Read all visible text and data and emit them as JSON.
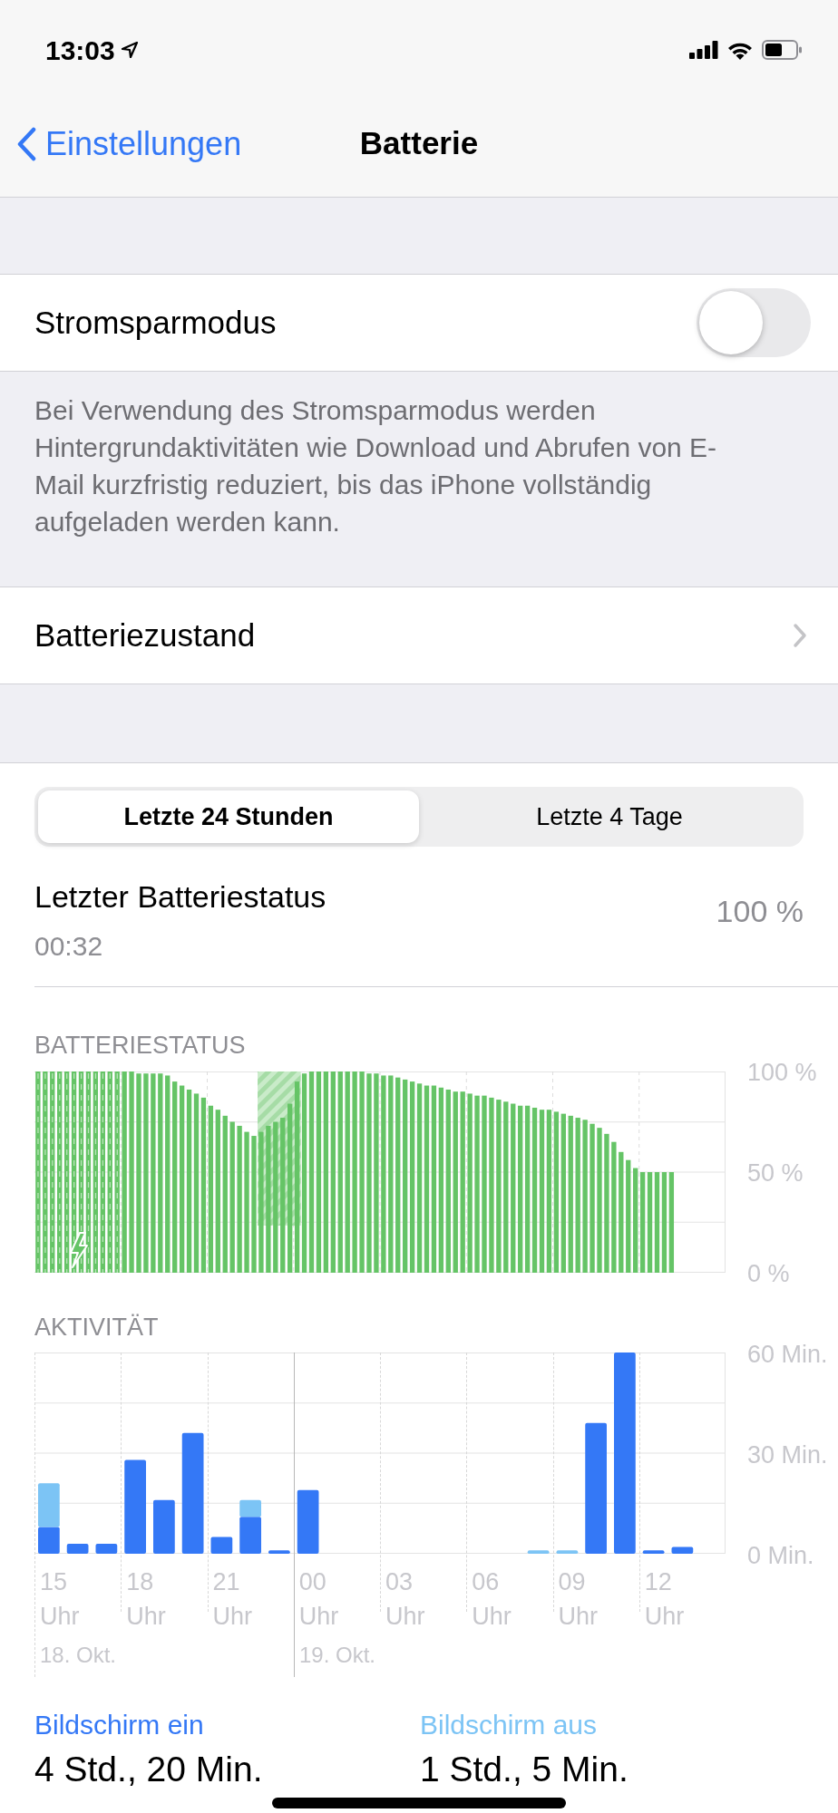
{
  "status_bar": {
    "time": "13:03"
  },
  "nav": {
    "back": "Einstellungen",
    "title": "Batterie"
  },
  "low_power": {
    "label": "Stromsparmodus",
    "on": false,
    "footer": "Bei Verwendung des Stromsparmodus werden Hintergrundaktivitäten wie Download und Abrufen von E-Mail kurzfristig reduziert, bis das iPhone vollständig aufgeladen werden kann."
  },
  "battery_health": {
    "label": "Batteriezustand"
  },
  "tabs": [
    {
      "label": "Letzte 24 Stunden",
      "selected": true
    },
    {
      "label": "Letzte 4 Tage",
      "selected": false
    }
  ],
  "last_status": {
    "label": "Letzter Batteriestatus",
    "time": "00:32",
    "value": "100 %"
  },
  "battery_chart": {
    "title": "BATTERIESTATUS",
    "chart_data": {
      "type": "bar",
      "grid": true,
      "ylim": [
        0,
        100
      ],
      "yticks": [
        {
          "value": 100,
          "label": "100 %"
        },
        {
          "value": 50,
          "label": "50 %"
        },
        {
          "value": 0,
          "label": "0 %"
        }
      ],
      "series": [
        {
          "color": "#65c466",
          "values": [
            100,
            100,
            100,
            100,
            100,
            100,
            100,
            100,
            100,
            100,
            100,
            100,
            100,
            100,
            99,
            99,
            99,
            99,
            98,
            95,
            93,
            91,
            89,
            87,
            83,
            81,
            78,
            75,
            73,
            70,
            68,
            70,
            73,
            75,
            77,
            84,
            95,
            99,
            100,
            100,
            100,
            100,
            100,
            100,
            100,
            100,
            99,
            99,
            98,
            98,
            97,
            96,
            95,
            94,
            93,
            93,
            92,
            91,
            90,
            90,
            89,
            88,
            88,
            87,
            86,
            85,
            84,
            83,
            83,
            82,
            81,
            81,
            80,
            79,
            78,
            77,
            76,
            74,
            72,
            69,
            65,
            60,
            56,
            52,
            50,
            50,
            50,
            50,
            50,
            null,
            null,
            null,
            null,
            null,
            null,
            null
          ]
        }
      ]
    }
  },
  "activity_chart": {
    "title": "AKTIVITÄT",
    "date_labels": [
      "18. Okt.",
      "19. Okt."
    ],
    "chart_data": {
      "type": "bar",
      "stacked": true,
      "grid": true,
      "ylim": [
        0,
        60
      ],
      "yticks": [
        {
          "value": 60,
          "label": "60 Min."
        },
        {
          "value": 30,
          "label": "30 Min."
        },
        {
          "value": 0,
          "label": "0 Min."
        }
      ],
      "categories": [
        "15 Uhr",
        null,
        null,
        "18 Uhr",
        null,
        null,
        "21 Uhr",
        null,
        null,
        "00 Uhr",
        null,
        null,
        "03 Uhr",
        null,
        null,
        "06 Uhr",
        null,
        null,
        "09 Uhr",
        null,
        null,
        "12 Uhr",
        null,
        null
      ],
      "series": [
        {
          "name": "Bildschirm ein",
          "color": "#3478f6",
          "values": [
            8,
            3,
            3,
            28,
            16,
            36,
            5,
            11,
            1,
            19,
            0,
            0,
            0,
            0,
            0,
            0,
            0,
            0,
            0,
            39,
            60,
            1,
            2,
            null
          ]
        },
        {
          "name": "Bildschirm aus",
          "color": "#7cc4f5",
          "values": [
            13,
            0,
            0,
            0,
            0,
            0,
            0,
            5,
            0,
            0,
            0,
            0,
            0,
            0,
            0,
            0,
            0,
            1,
            1,
            0,
            0,
            0,
            0,
            null
          ]
        }
      ]
    }
  },
  "totals": [
    {
      "value": "4 Std., 20 Min."
    },
    {
      "value": "1 Std., 5 Min."
    }
  ]
}
